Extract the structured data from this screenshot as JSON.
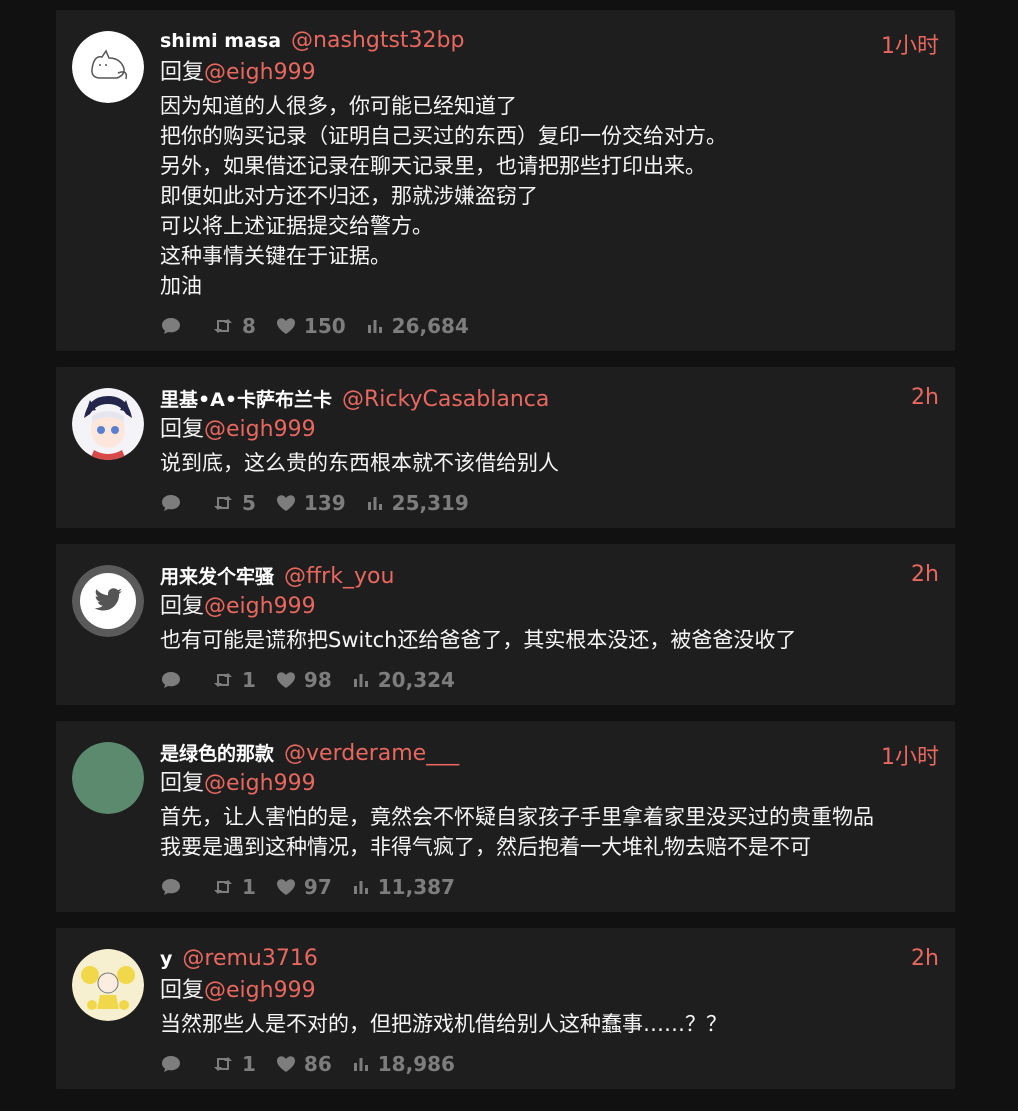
{
  "colors": {
    "accent": "#e8675f",
    "card": "#1e1e1e",
    "background": "#111111",
    "muted": "#7d7d7d"
  },
  "tweets": [
    {
      "name": "shimi masa",
      "handle": "@nashgtst32bp",
      "time": "1小时",
      "reply_prefix": "回复",
      "reply_to": "@eigh999",
      "lines": [
        "因为知道的人很多，你可能已经知道了",
        "把你的购买记录（证明自己买过的东西）复印一份交给对方。",
        "另外，如果借还记录在聊天记录里，也请把那些打印出来。",
        "即便如此对方还不归还，那就涉嫌盗窃了",
        "可以将上述证据提交给警方。",
        "这种事情关键在于证据。",
        "加油"
      ],
      "retweets": "8",
      "likes": "150",
      "views": "26,684",
      "avatar": "cat-sketch-avatar"
    },
    {
      "name": "里基•A•卡萨布兰卡",
      "handle": "@RickyCasablanca",
      "time": "2h",
      "reply_prefix": "回复",
      "reply_to": "@eigh999",
      "lines": [
        "说到底，这么贵的东西根本就不该借给别人"
      ],
      "retweets": "5",
      "likes": "139",
      "views": "25,319",
      "avatar": "anime-girl-avatar"
    },
    {
      "name": "用来发个牢骚",
      "handle": "@ffrk_you",
      "time": "2h",
      "reply_prefix": "回复",
      "reply_to": "@eigh999",
      "lines": [
        "也有可能是谎称把Switch还给爸爸了，其实根本没还，被爸爸没收了"
      ],
      "retweets": "1",
      "likes": "98",
      "views": "20,324",
      "avatar": "twitter-bird-avatar"
    },
    {
      "name": "是绿色的那款",
      "handle": "@verderame___",
      "time": "1小时",
      "reply_prefix": "回复",
      "reply_to": "@eigh999",
      "lines": [
        "首先，让人害怕的是，竟然会不怀疑自家孩子手里拿着家里没买过的贵重物品",
        "我要是遇到这种情况，非得气疯了，然后抱着一大堆礼物去赔不是不可"
      ],
      "retweets": "1",
      "likes": "97",
      "views": "11,387",
      "avatar": "green-circle-avatar"
    },
    {
      "name": "y",
      "handle": "@remu3716",
      "time": "2h",
      "reply_prefix": "回复",
      "reply_to": "@eigh999",
      "lines": [
        "当然那些人是不对的，但把游戏机借给别人这种蠢事……？？"
      ],
      "retweets": "1",
      "likes": "86",
      "views": "18,986",
      "avatar": "cheerleader-avatar"
    }
  ]
}
